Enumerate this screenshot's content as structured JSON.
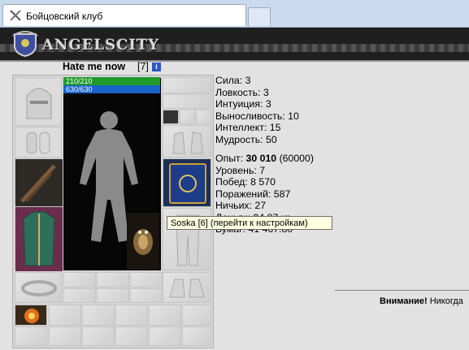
{
  "browser": {
    "tab_title": "Бойцовский клуб",
    "tab_icon": "crossed-swords-icon"
  },
  "site": {
    "logo_text": "ANGELSCITY",
    "logo_icon": "shield-crest-icon"
  },
  "character": {
    "name": "Hate me now",
    "level": "[7]",
    "info_icon_label": "i",
    "hp": "210/210",
    "mp": "630/630"
  },
  "stats": {
    "strength": "Сила: 3",
    "agility": "Ловкость: 3",
    "intuition": "Интуиция: 3",
    "endurance": "Выносливость: 10",
    "intellect": "Интеллект: 15",
    "wisdom": "Мудрость: 50",
    "experience_label": "Опыт: ",
    "experience_value": "30 010",
    "experience_next": " (60000)",
    "level": "Уровень: 7",
    "wins": "Побед: 8 570",
    "losses": "Поражений: 587",
    "draws": "Ничьих: 27",
    "money_partial": "Деньги: 94.87 кр.",
    "other_partial": "Бумаг: 41 467.80"
  },
  "tooltip": {
    "text": "Soska [6] (перейти к настройкам)"
  },
  "notice": {
    "label": "Внимание!",
    "text": " Никогда"
  },
  "colors": {
    "hp_bar": "#1e9a2a",
    "mp_bar": "#1a63c9",
    "tooltip_bg": "#ffffe1"
  }
}
